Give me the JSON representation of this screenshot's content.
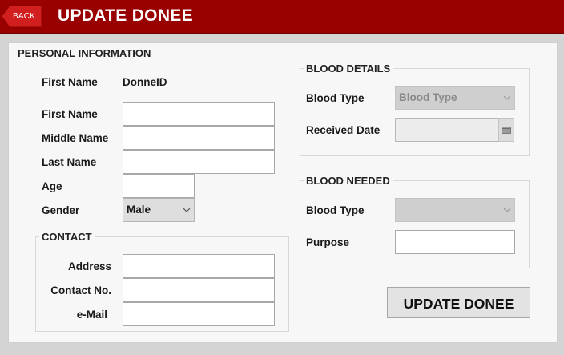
{
  "header": {
    "back_label": "BACK",
    "title": "UPDATE DONEE"
  },
  "personal": {
    "legend": "PERSONAL INFORMATION",
    "id_label": "First Name",
    "id_value": "DonneID",
    "first_name_label": "First Name",
    "first_name_value": "",
    "middle_name_label": "Middle Name",
    "middle_name_value": "",
    "last_name_label": "Last Name",
    "last_name_value": "",
    "age_label": "Age",
    "age_value": "",
    "gender_label": "Gender",
    "gender_value": "Male"
  },
  "contact": {
    "legend": "CONTACT",
    "address_label": "Address",
    "address_value": "",
    "contact_no_label": "Contact No.",
    "contact_no_value": "",
    "email_label": "e-Mail",
    "email_value": ""
  },
  "blood_details": {
    "legend": "BLOOD DETAILS",
    "blood_type_label": "Blood Type",
    "blood_type_value": "Blood Type",
    "received_date_label": "Received Date",
    "received_date_value": ""
  },
  "blood_needed": {
    "legend": "BLOOD NEEDED",
    "blood_type_label": "Blood Type",
    "blood_type_value": "",
    "purpose_label": "Purpose",
    "purpose_value": ""
  },
  "actions": {
    "update_label": "UPDATE DONEE"
  },
  "icons": {
    "back": "back-arrow-icon",
    "dropdown": "chevron-down-icon",
    "calendar": "calendar-icon"
  },
  "colors": {
    "header_bg": "#990000",
    "back_button": "#d11f1f",
    "panel_bg": "#f7f7f7",
    "window_bg": "#d4d4d4"
  }
}
